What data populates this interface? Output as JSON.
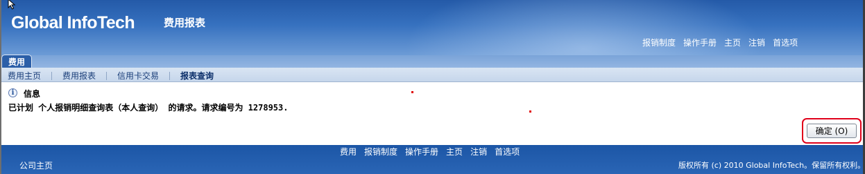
{
  "header": {
    "brand": "Global InfoTech",
    "module_title": "费用报表",
    "links": [
      "报销制度",
      "操作手册",
      "主页",
      "注销",
      "首选项"
    ]
  },
  "tabs": {
    "active": "费用"
  },
  "subnav": {
    "items": [
      {
        "label": "费用主页"
      },
      {
        "label": "费用报表"
      },
      {
        "label": "信用卡交易"
      },
      {
        "label": "报表查询",
        "current": true
      }
    ]
  },
  "message": {
    "icon": "info-icon",
    "title": "信息",
    "text": "已计划 个人报销明细查询表（本人查询） 的请求。请求编号为 1278953."
  },
  "ok_button": {
    "label": "确定 (O)"
  },
  "footer": {
    "links": [
      "费用",
      "报销制度",
      "操作手册",
      "主页",
      "注销",
      "首选项"
    ],
    "company_home": "公司主页",
    "copyright": "版权所有 (c) 2010 Global InfoTech。保留所有权利。"
  },
  "colors": {
    "header_blue": "#3671bf",
    "footer_blue": "#2a65b5",
    "subnav_bg": "#d9e5f3",
    "highlight_red": "#e0001a"
  }
}
